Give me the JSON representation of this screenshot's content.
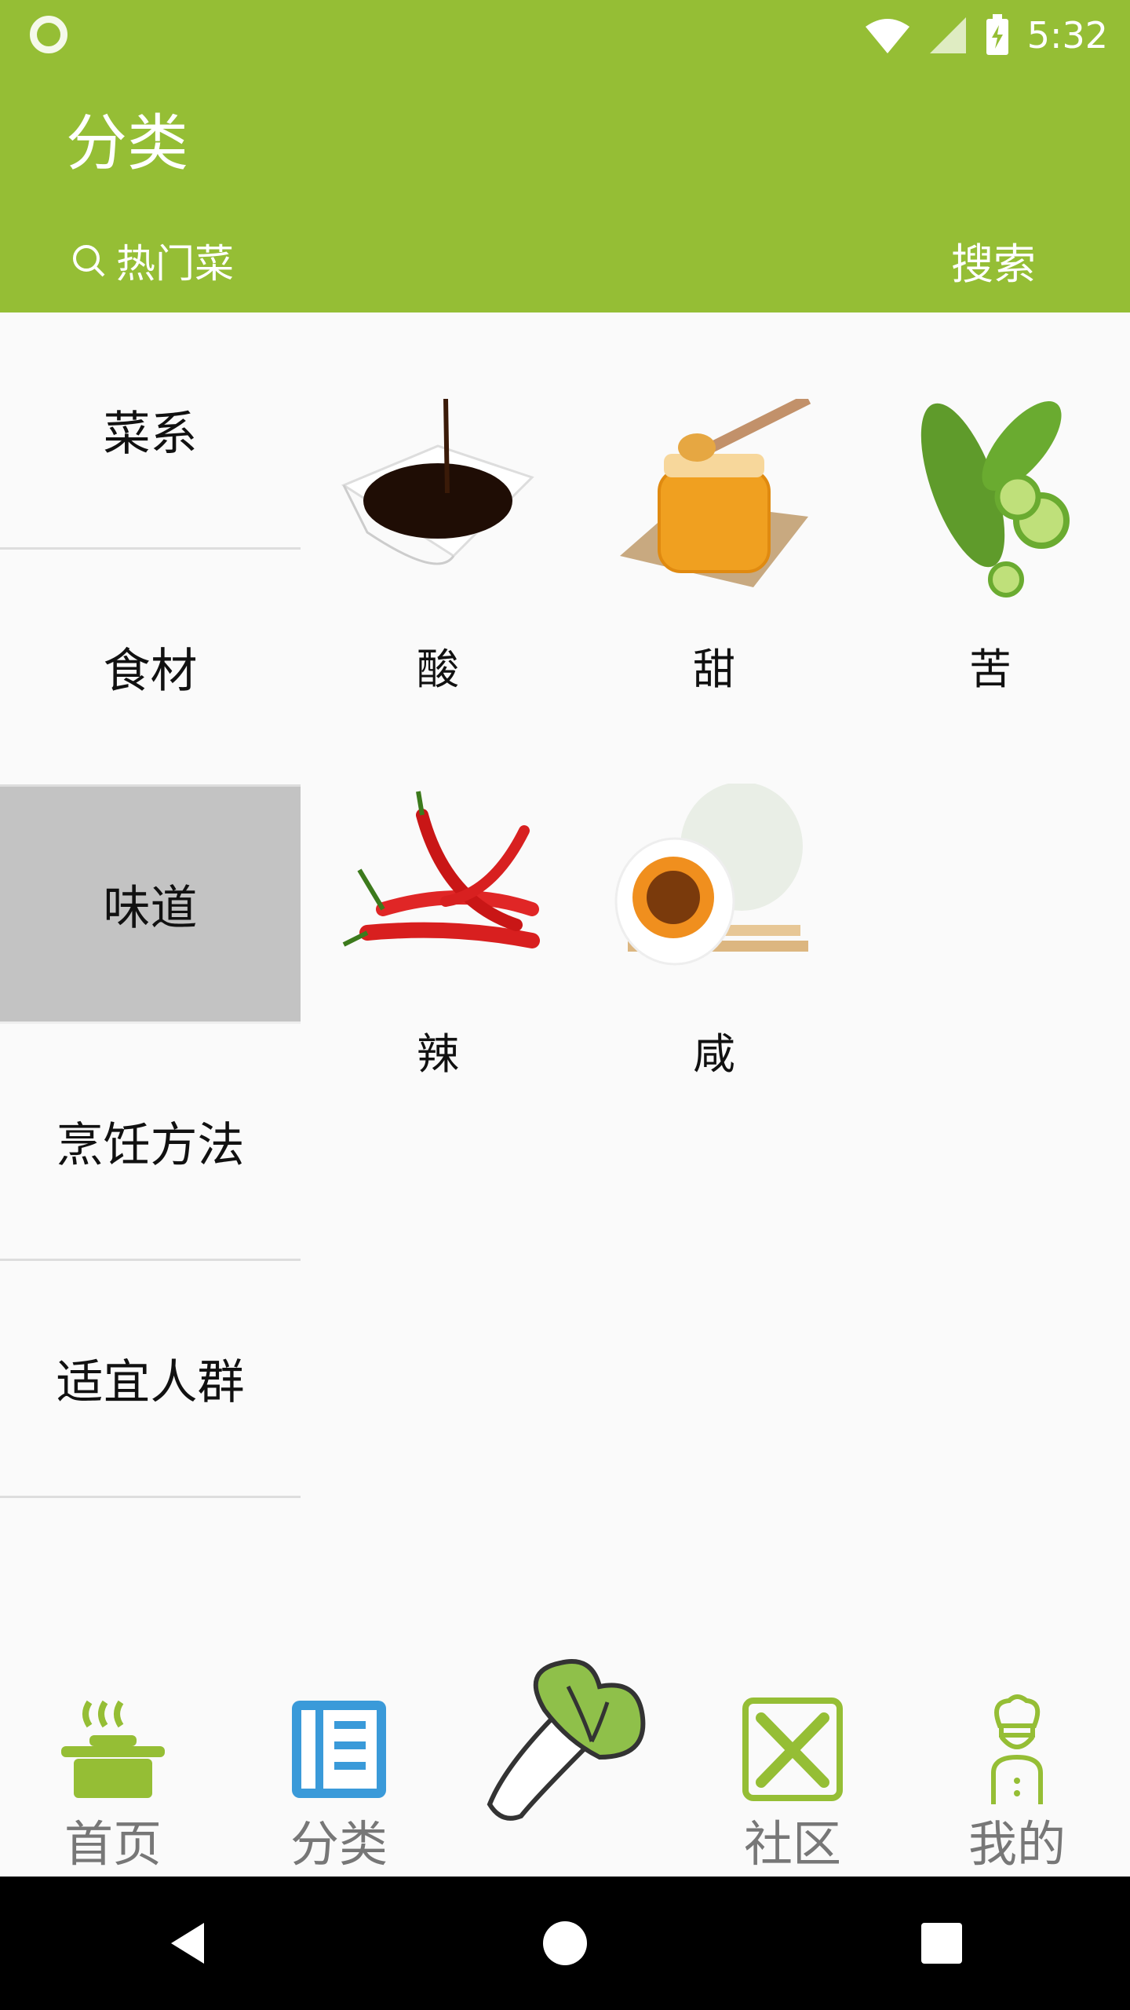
{
  "status_bar": {
    "time": "5:32"
  },
  "header": {
    "title": "分类",
    "search_placeholder": "热门菜",
    "search_button": "搜索"
  },
  "sidebar": {
    "items": [
      {
        "label": "菜系"
      },
      {
        "label": "食材"
      },
      {
        "label": "味道"
      },
      {
        "label": "烹饪方法"
      },
      {
        "label": "适宜人群"
      }
    ],
    "active_index": 2
  },
  "flavors": [
    {
      "label": "酸",
      "icon": "soy-sauce-image"
    },
    {
      "label": "甜",
      "icon": "honey-image"
    },
    {
      "label": "苦",
      "icon": "bitter-melon-image"
    },
    {
      "label": "辣",
      "icon": "chili-image"
    },
    {
      "label": "咸",
      "icon": "salted-egg-image"
    }
  ],
  "bottom_nav": {
    "tabs": [
      {
        "label": "首页",
        "icon": "pot-icon"
      },
      {
        "label": "分类",
        "icon": "notebook-icon",
        "active": true
      },
      {
        "label": "",
        "icon": "cabbage-icon"
      },
      {
        "label": "社区",
        "icon": "fork-knife-icon"
      },
      {
        "label": "我的",
        "icon": "chef-icon"
      }
    ]
  },
  "colors": {
    "accent": "#95be35",
    "active_tab": "#3a9ad9",
    "sidebar_active": "#c3c3c3"
  }
}
